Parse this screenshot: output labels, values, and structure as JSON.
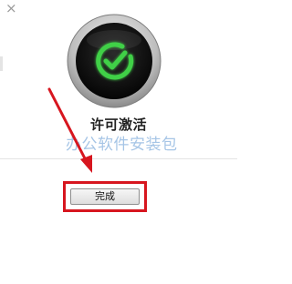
{
  "window": {
    "close_glyph": "×"
  },
  "status": {
    "title": "许可激活",
    "icon": "checkmark-success-icon",
    "accent_color": "#3fd046"
  },
  "watermark": {
    "text": "办公软件安装包"
  },
  "actions": {
    "done_label": "完成"
  },
  "annotation": {
    "color": "#d7161f"
  }
}
